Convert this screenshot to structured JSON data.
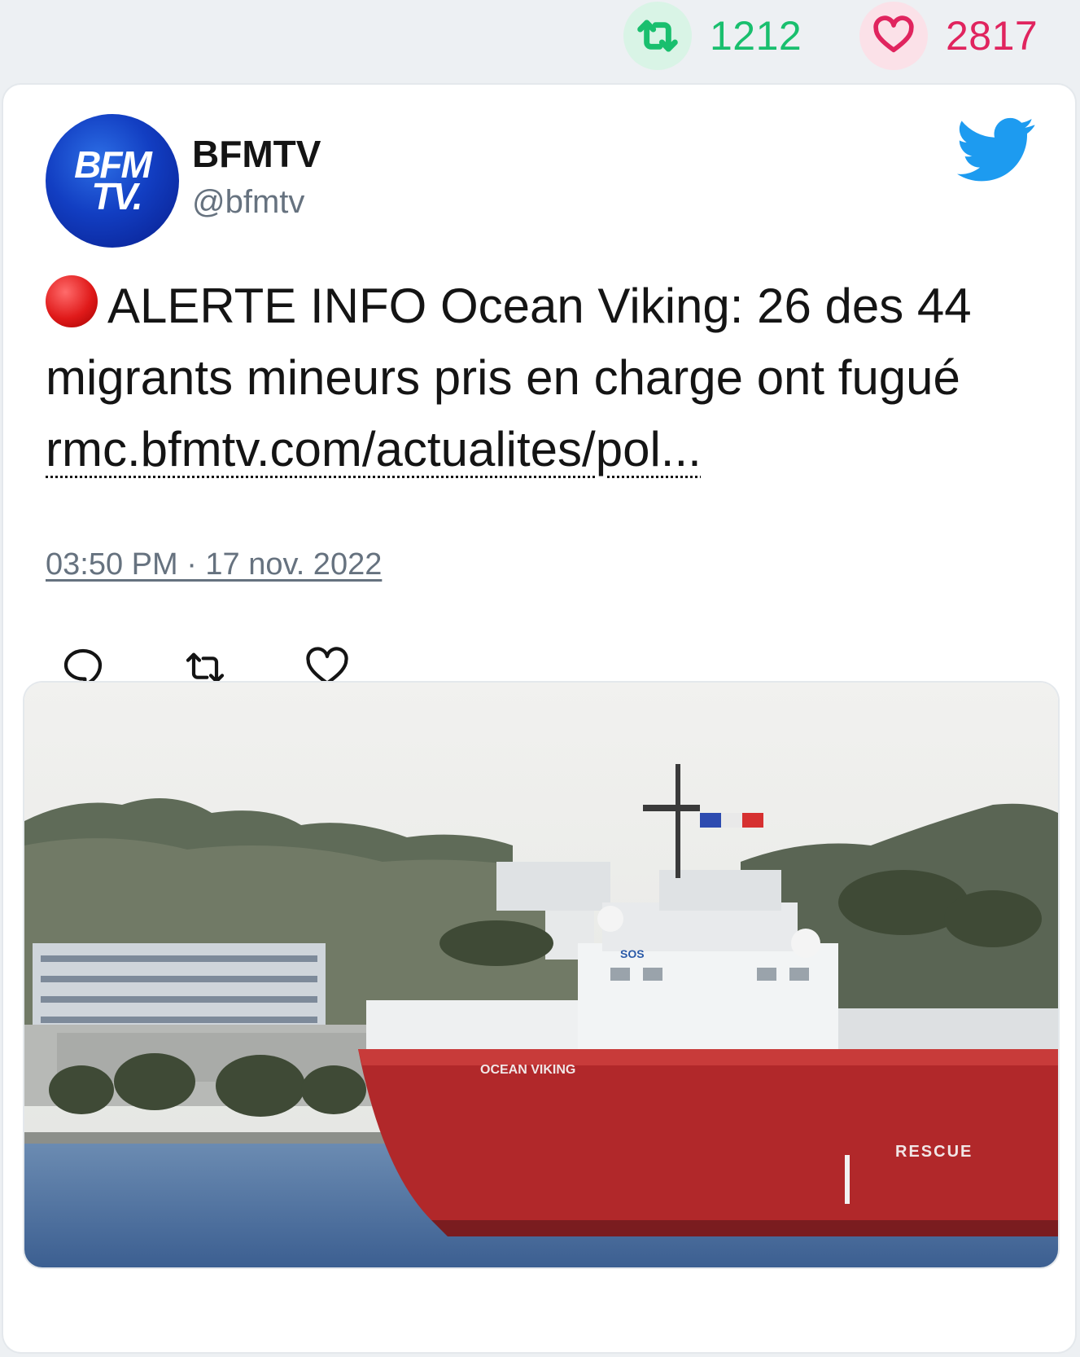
{
  "stats": {
    "retweets": "1212",
    "likes": "2817"
  },
  "author": {
    "avatar_line1": "BFM",
    "avatar_line2": "TV.",
    "display_name": "BFMTV",
    "handle": "@bfmtv"
  },
  "tweet": {
    "text": "ALERTE INFO Ocean Viking: 26 des 44 migrants mineurs pris en charge ont fugué",
    "link": "rmc.bfmtv.com/actualites/pol...",
    "timestamp": "03:50 PM · 17 nov. 2022"
  },
  "media": {
    "ship_name": "OCEAN VIKING",
    "hull_text": "RESCUE",
    "bridge_text": "SOS"
  },
  "icons": {
    "retweet": "retweet-icon",
    "like": "heart-icon",
    "reply": "reply-icon",
    "brand": "twitter-bird-icon",
    "alert": "red-circle-icon"
  },
  "colors": {
    "retweet": "#19bf6e",
    "like": "#e0245e",
    "twitter_blue": "#1d9bf0",
    "muted": "#66727f"
  }
}
